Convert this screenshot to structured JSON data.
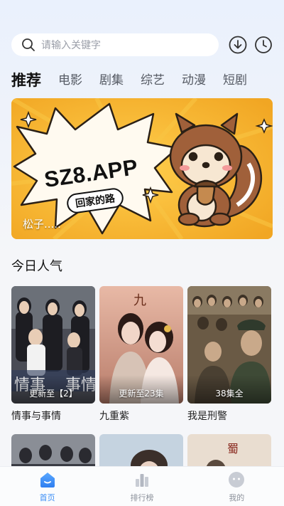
{
  "search": {
    "placeholder": "请输入关键字"
  },
  "header_icons": [
    "download-icon",
    "history-clock-icon"
  ],
  "tabs": [
    "推荐",
    "电影",
    "剧集",
    "综艺",
    "动漫",
    "短剧"
  ],
  "active_tab": "推荐",
  "banner": {
    "title": "SZ8.APP",
    "subtitle": "回家的路",
    "caption": "松子....."
  },
  "section": {
    "title": "今日人气"
  },
  "cards": [
    {
      "name": "情事与事情",
      "episode": "更新至【2】"
    },
    {
      "name": "九重紫",
      "episode": "更新至23集"
    },
    {
      "name": "我是刑警",
      "episode": "38集全"
    }
  ],
  "bottom_nav": [
    {
      "label": "首页",
      "icon": "home-icon",
      "active": true
    },
    {
      "label": "排行榜",
      "icon": "ranking-icon",
      "active": false
    },
    {
      "label": "我的",
      "icon": "profile-icon",
      "active": false
    }
  ],
  "colors": {
    "accent": "#3b8df5",
    "banner_bg": "#f6b532",
    "page_bg": "#eef2fa"
  }
}
